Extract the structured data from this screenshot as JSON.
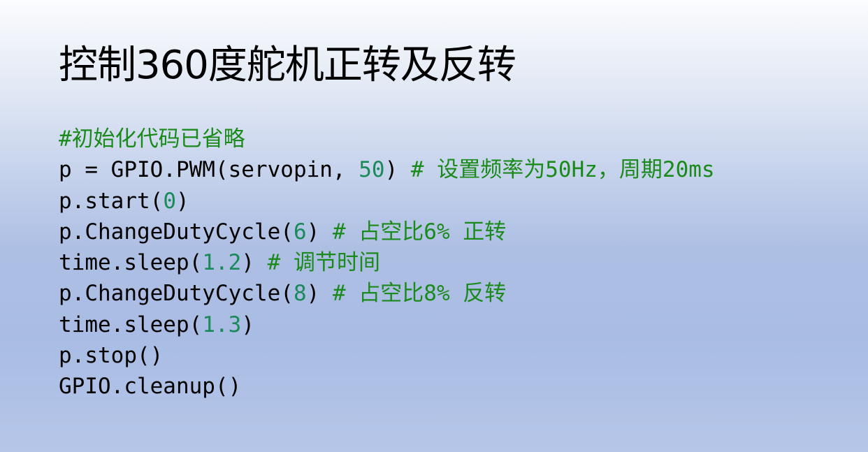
{
  "slide": {
    "title": "控制360度舵机正转及反转",
    "code_lines": [
      {
        "segments": [
          {
            "type": "comment",
            "text": "#初始化代码已省略"
          }
        ]
      },
      {
        "segments": [
          {
            "type": "plain",
            "text": "p = GPIO.PWM(servopin, "
          },
          {
            "type": "number",
            "text": "50"
          },
          {
            "type": "plain",
            "text": ") "
          },
          {
            "type": "comment",
            "text": "# 设置频率为50Hz，周期20ms"
          }
        ]
      },
      {
        "segments": [
          {
            "type": "plain",
            "text": "p.start("
          },
          {
            "type": "number",
            "text": "0"
          },
          {
            "type": "plain",
            "text": ")"
          }
        ]
      },
      {
        "segments": [
          {
            "type": "plain",
            "text": "p.ChangeDutyCycle("
          },
          {
            "type": "number",
            "text": "6"
          },
          {
            "type": "plain",
            "text": ") "
          },
          {
            "type": "comment",
            "text": "# 占空比6% 正转"
          }
        ]
      },
      {
        "segments": [
          {
            "type": "plain",
            "text": "time.sleep("
          },
          {
            "type": "number",
            "text": "1.2"
          },
          {
            "type": "plain",
            "text": ") "
          },
          {
            "type": "comment",
            "text": "# 调节时间"
          }
        ]
      },
      {
        "segments": [
          {
            "type": "plain",
            "text": "p.ChangeDutyCycle("
          },
          {
            "type": "number",
            "text": "8"
          },
          {
            "type": "plain",
            "text": ") "
          },
          {
            "type": "comment",
            "text": "# 占空比8% 反转"
          }
        ]
      },
      {
        "segments": [
          {
            "type": "plain",
            "text": "time.sleep("
          },
          {
            "type": "number",
            "text": "1.3"
          },
          {
            "type": "plain",
            "text": ")"
          }
        ]
      },
      {
        "segments": [
          {
            "type": "plain",
            "text": "p.stop()"
          }
        ]
      },
      {
        "segments": [
          {
            "type": "plain",
            "text": "GPIO.cleanup()"
          }
        ]
      }
    ]
  },
  "colors": {
    "comment": "#1a8a1a",
    "number": "#1a8a5a",
    "plain": "#000000"
  }
}
